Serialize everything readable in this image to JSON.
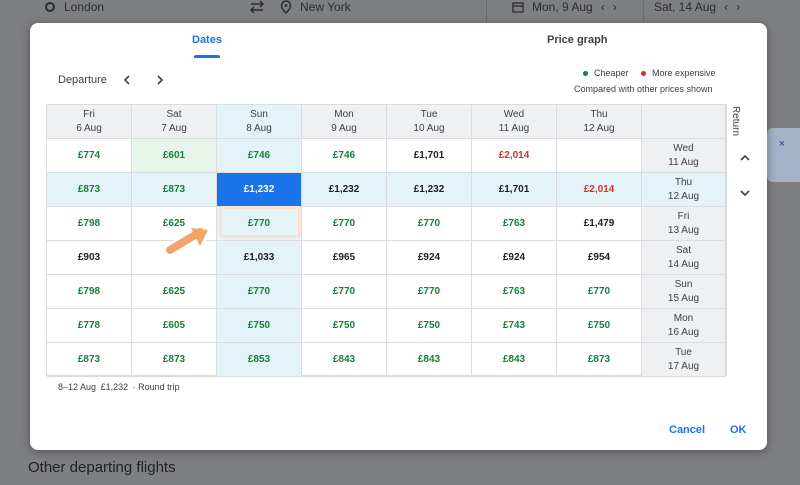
{
  "background": {
    "origin": "London",
    "destination": "New York",
    "depart_date": "Mon, 9 Aug",
    "return_date": "Sat, 14 Aug",
    "section_heading": "Other departing flights",
    "side_close": "×"
  },
  "dialog": {
    "tabs": [
      "Dates",
      "Price graph"
    ],
    "nav_label": "Departure",
    "legend": {
      "cheaper": "Cheaper",
      "more_expensive": "More expensive",
      "note": "Compared with other prices shown"
    },
    "return_label": "Return",
    "columns": [
      {
        "day": "Fri",
        "date": "6 Aug"
      },
      {
        "day": "Sat",
        "date": "7 Aug"
      },
      {
        "day": "Sun",
        "date": "8 Aug"
      },
      {
        "day": "Mon",
        "date": "9 Aug"
      },
      {
        "day": "Tue",
        "date": "10 Aug"
      },
      {
        "day": "Wed",
        "date": "11 Aug"
      },
      {
        "day": "Thu",
        "date": "12 Aug"
      }
    ],
    "rows": [
      {
        "day": "Wed",
        "date": "11 Aug",
        "prices": [
          "£774",
          "£601",
          "£746",
          "£746",
          "£1,701",
          "£2,014",
          ""
        ],
        "tones": [
          "green",
          "green",
          "green",
          "green",
          "black",
          "red",
          "black"
        ]
      },
      {
        "day": "Thu",
        "date": "12 Aug",
        "prices": [
          "£873",
          "£873",
          "£1,232",
          "£1,232",
          "£1,232",
          "£1,701",
          "£2,014"
        ],
        "tones": [
          "green",
          "green",
          "selected",
          "black",
          "black",
          "black",
          "red"
        ]
      },
      {
        "day": "Fri",
        "date": "13 Aug",
        "prices": [
          "£798",
          "£625",
          "£770",
          "£770",
          "£770",
          "£763",
          "£1,479"
        ],
        "tones": [
          "green",
          "green",
          "green",
          "green",
          "green",
          "green",
          "black"
        ]
      },
      {
        "day": "Sat",
        "date": "14 Aug",
        "prices": [
          "£903",
          "",
          "£1,033",
          "£965",
          "£924",
          "£924",
          "£954"
        ],
        "tones": [
          "black",
          "black",
          "black",
          "black",
          "black",
          "black",
          "black"
        ]
      },
      {
        "day": "Sun",
        "date": "15 Aug",
        "prices": [
          "£798",
          "£625",
          "£770",
          "£770",
          "£770",
          "£763",
          "£770"
        ],
        "tones": [
          "green",
          "green",
          "green",
          "green",
          "green",
          "green",
          "green"
        ]
      },
      {
        "day": "Mon",
        "date": "16 Aug",
        "prices": [
          "£778",
          "£605",
          "£750",
          "£750",
          "£750",
          "£743",
          "£750"
        ],
        "tones": [
          "green",
          "green",
          "green",
          "green",
          "green",
          "green",
          "green"
        ]
      },
      {
        "day": "Tue",
        "date": "17 Aug",
        "prices": [
          "£873",
          "£873",
          "£853",
          "£843",
          "£843",
          "£843",
          "£873"
        ],
        "tones": [
          "green",
          "green",
          "green",
          "green",
          "green",
          "green",
          "green"
        ]
      }
    ],
    "summary": {
      "dates": "8–12 Aug",
      "price": "£1,232",
      "trip": "· Round trip"
    },
    "cancel_label": "Cancel",
    "ok_label": "OK"
  },
  "colors": {
    "accent": "#1a73e8",
    "cheaper": "#188038",
    "more_expensive": "#d93025",
    "highlight": "#f4a46b"
  }
}
